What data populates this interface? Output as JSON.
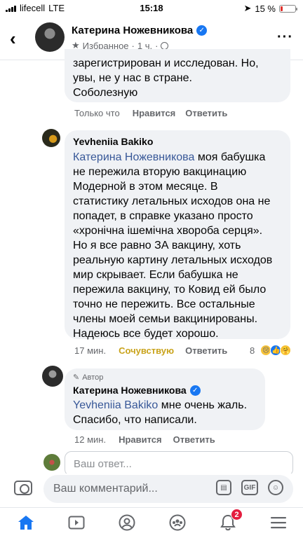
{
  "status_bar": {
    "carrier": "lifecell",
    "network": "LTE",
    "time": "15:18",
    "battery": "15 %",
    "battery_level": 0.15
  },
  "header": {
    "name": "Катерина Ножевникова",
    "favorites": "Избранное",
    "time": "1 ч.",
    "dot": "·"
  },
  "comments": [
    {
      "text": "зарегистрирован и исследован. Но,\nувы, не у нас в стране.\nСоболезную",
      "time": "Только что",
      "like": "Нравится",
      "reply": "Ответить"
    },
    {
      "author": "Yevheniia Bakiko",
      "mention": "Катерина Ножевникова",
      "text": " моя бабушка\nне пережила вторую вакцинацию\nМодерной в этом месяце. В\nстатистику летальных исходов она не\nпопадет, в справке указано просто\n«хронічна ішемічна хвороба серця».\nНо я все равно ЗА вакцину, хоть\nреальную картину летальных исходов\nмир скрывает. Если бабушка не\nпережила вакцину, то Ковид ей было\nточно не пережить. Все остальные\nчлены моей семьи вакцинированы.\nНадеюсь все будет хорошо.",
      "time": "17 мин.",
      "reaction_label": "Сочувствую",
      "reply": "Ответить",
      "reaction_count": "8"
    },
    {
      "author_badge": "Автор",
      "author": "Катерина Ножевникова",
      "mention": "Yevheniia Bakiko",
      "text": " мне очень жаль.\nСпасибо, что написали.",
      "time": "12 мин.",
      "like": "Нравится",
      "reply": "Ответить"
    }
  ],
  "reply_box": {
    "placeholder": "Ваш ответ..."
  },
  "composer": {
    "placeholder": "Ваш комментарий...",
    "gif": "GIF"
  },
  "nav": {
    "notification_badge": "2"
  },
  "colors": {
    "accent": "#1877f2",
    "mention": "#385898",
    "care_reaction": "#c9a31b",
    "bubble": "#f0f2f5"
  }
}
